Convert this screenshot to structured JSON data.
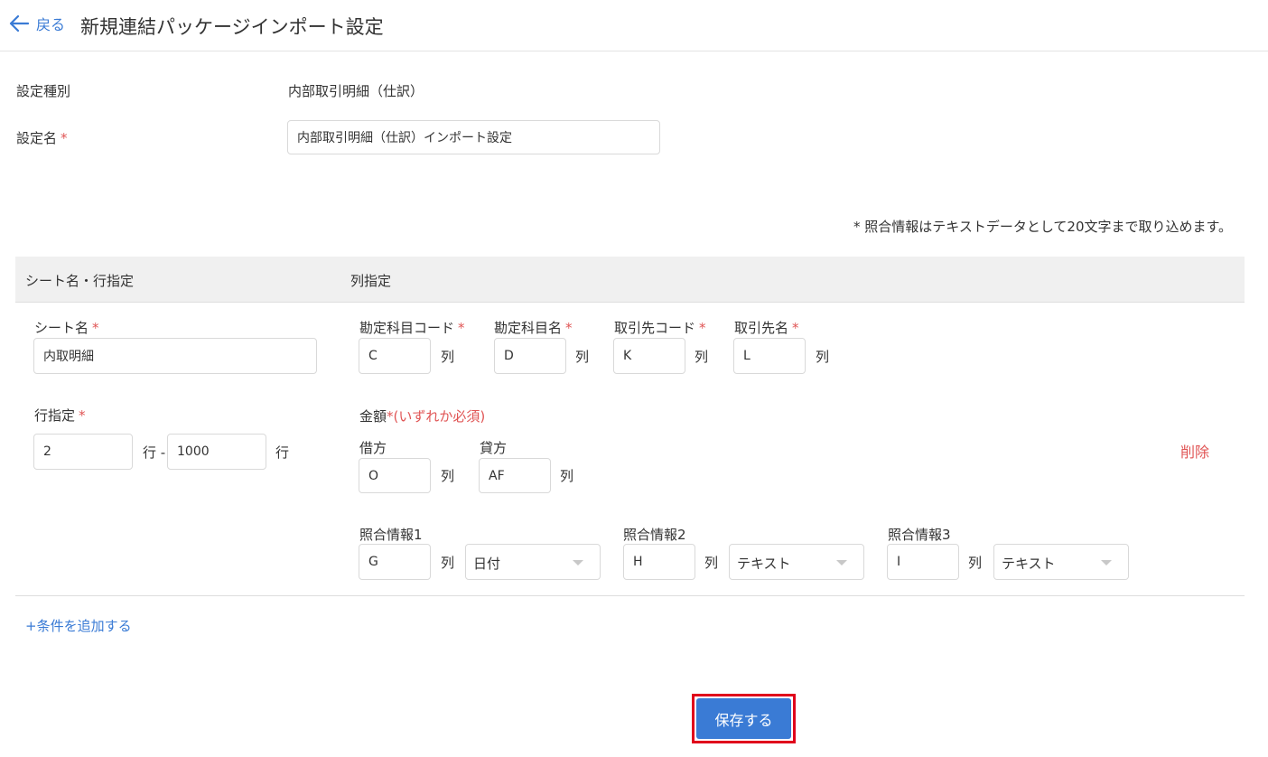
{
  "header": {
    "back_label": "戻る",
    "title": "新規連結パッケージインポート設定"
  },
  "form": {
    "setting_type_label": "設定種別",
    "setting_type_value": "内部取引明細（仕訳）",
    "setting_name_label": "設定名",
    "required_mark": "*",
    "setting_name_value": "内部取引明細（仕訳）インポート設定"
  },
  "note": "* 照合情報はテキストデータとして20文字まで取り込めます。",
  "table": {
    "col1_header": "シート名・行指定",
    "col2_header": "列指定"
  },
  "condition": {
    "sheet_name_label": "シート名",
    "sheet_name_value": "内取明細",
    "row_spec_label": "行指定",
    "row_from": "2",
    "row_unit_dash": "行 -",
    "row_to": "1000",
    "row_unit": "行",
    "col_unit": "列",
    "account_code_label": "勘定科目コード",
    "account_code_value": "C",
    "account_name_label": "勘定科目名",
    "account_name_value": "D",
    "partner_code_label": "取引先コード",
    "partner_code_value": "K",
    "partner_name_label": "取引先名",
    "partner_name_value": "L",
    "amount_label": "金額",
    "amount_required": "*(いずれか必須)",
    "debit_label": "借方",
    "debit_value": "O",
    "credit_label": "貸方",
    "credit_value": "AF",
    "ref1_label": "照合情報1",
    "ref1_value": "G",
    "ref1_type": "日付",
    "ref2_label": "照合情報2",
    "ref2_value": "H",
    "ref2_type": "テキスト",
    "ref3_label": "照合情報3",
    "ref3_value": "I",
    "ref3_type": "テキスト",
    "delete_label": "削除"
  },
  "add_condition_label": "+条件を追加する",
  "save_label": "保存する",
  "colors": {
    "accent": "#3a7bd5",
    "danger": "#e05555",
    "highlight_border": "#e0001b"
  },
  "icons": {
    "back": "arrow-left-icon",
    "dropdown": "chevron-down-icon"
  }
}
